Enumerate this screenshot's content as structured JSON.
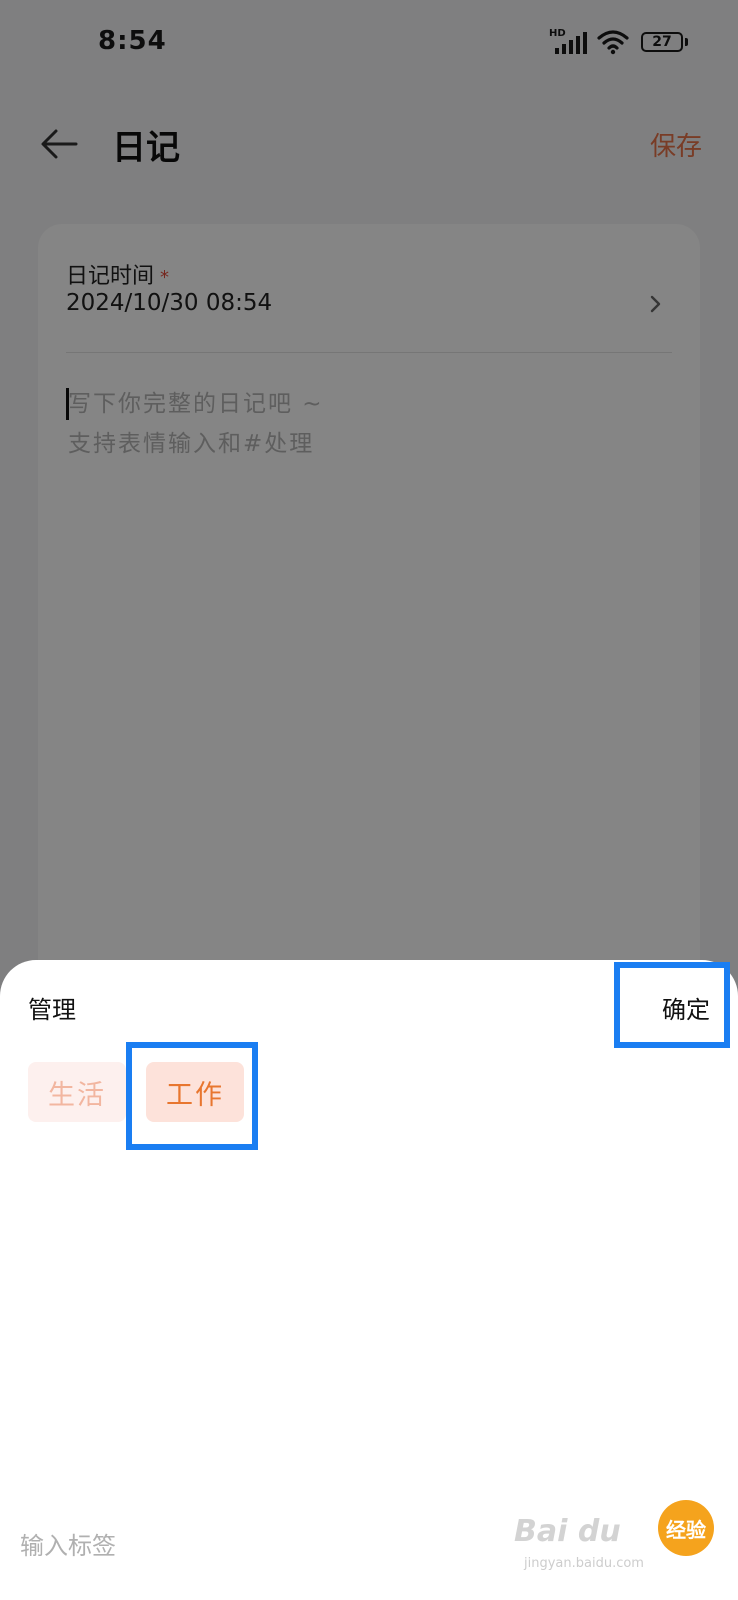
{
  "status_bar": {
    "time": "8:54",
    "network_label": "HD",
    "battery": "27"
  },
  "header": {
    "title": "日记",
    "save_label": "保存"
  },
  "card": {
    "time_label": "日记时间",
    "required_mark": "*",
    "time_value": "2024/10/30 08:54",
    "placeholder_line1": "写下你完整的日记吧 ~",
    "placeholder_line2": "支持表情输入和#处理"
  },
  "sheet": {
    "title": "管理",
    "confirm_label": "确定",
    "tags": [
      {
        "label": "生活"
      },
      {
        "label": "工作"
      }
    ],
    "input_placeholder": "输入标签"
  },
  "watermark": {
    "text": "Bai du",
    "badge": "经验",
    "url": "jingyan.baidu.com"
  },
  "colors": {
    "accent": "#e8734a",
    "highlight": "#1a7ef2",
    "tag_work_bg": "#fde2da",
    "tag_work_text": "#e8762f",
    "tag_life_bg": "#fdf0ee",
    "tag_life_text": "#f2b6a0"
  },
  "icons": {
    "back": "arrow-left-icon",
    "chevron": "chevron-right-icon",
    "wifi": "wifi-icon",
    "signal": "signal-icon",
    "battery": "battery-icon"
  }
}
